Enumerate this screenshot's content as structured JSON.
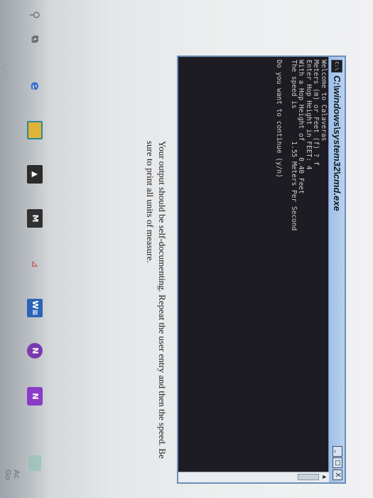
{
  "window": {
    "title": "C:\\windows\\system32\\cmd.exe",
    "icon_label": "C:\\",
    "minimize_label": "_",
    "maximize_label": "□",
    "close_label": "X"
  },
  "console": {
    "lines": [
      "Welcome to Calaveras",
      "Meters (m) or Feet (f) ? f",
      "Enter Hop Height in FEET: 4",
      "With a Hop Height of    0.40 Feet",
      "The speed is        1.55 Meters Per Second",
      "",
      "Do you want to continue (y/n)"
    ]
  },
  "instruction": {
    "text": "Your output should be self-documenting.  Repeat the user entry and then the speed.  Be sure to print all units of measure."
  },
  "taskbar": {
    "icons": [
      "search-icon",
      "task-view-icon",
      "edge-icon",
      "file-explorer-icon",
      "store-icon",
      "app-icon",
      "app-icon",
      "word-icon",
      "onenote-icon",
      "onenote-icon"
    ],
    "search_glyph": "⚲",
    "taskview_glyph": "⧉",
    "edge_glyph": "e",
    "store_glyph": "▲",
    "app_glyph": "M",
    "app2_glyph": "⊿",
    "word_glyph": "W≡",
    "onenote_glyph": "N",
    "onenote2_glyph": "N"
  },
  "watermark": {
    "line1": "Ac",
    "line2": "Go"
  },
  "colors": {
    "console_bg": "#1c1c22",
    "console_text": "#cfcfcf",
    "titlebar": "#a9c8ee",
    "taskbar": "#9ba1a7"
  }
}
